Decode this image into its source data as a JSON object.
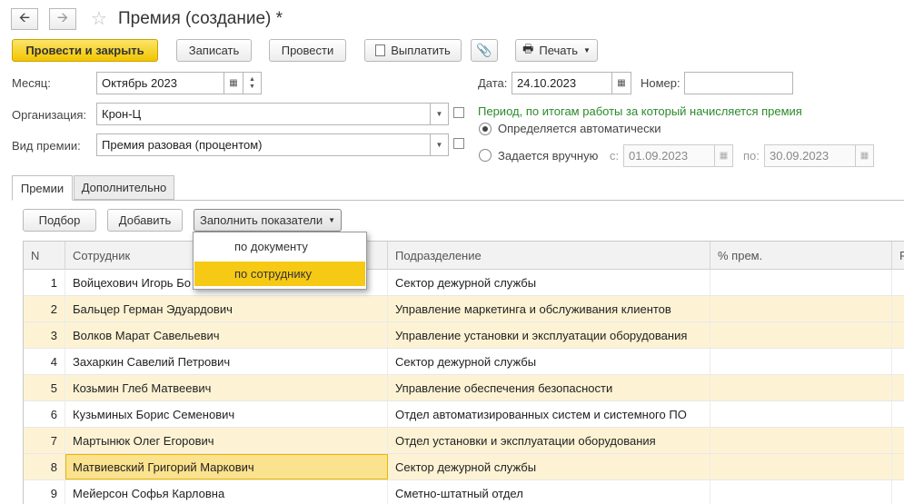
{
  "window": {
    "title": "Премия (создание) *",
    "back_icon": "arrow-left-icon",
    "forward_icon": "arrow-right-icon",
    "favorite_icon": "star-icon"
  },
  "toolbar": {
    "post_close": "Провести и закрыть",
    "save": "Записать",
    "post": "Провести",
    "pay": "Выплатить",
    "print": "Печать"
  },
  "form": {
    "month_label": "Месяц:",
    "month_value": "Октябрь 2023",
    "date_label": "Дата:",
    "date_value": "24.10.2023",
    "number_label": "Номер:",
    "number_value": "",
    "org_label": "Организация:",
    "org_value": "Крон-Ц",
    "bonus_type_label": "Вид премии:",
    "bonus_type_value": "Премия разовая (процентом)",
    "period_caption": "Период, по итогам работы за который начисляется премия",
    "radio_auto": "Определяется автоматически",
    "radio_manual": "Задается вручную",
    "from_label": "с:",
    "from_value": "01.09.2023",
    "to_label": "по:",
    "to_value": "30.09.2023"
  },
  "tabs": [
    "Премии",
    "Дополнительно"
  ],
  "grid_toolbar": {
    "select": "Подбор",
    "add": "Добавить",
    "fill": "Заполнить показатели"
  },
  "fill_menu": [
    "по документу",
    "по сотруднику"
  ],
  "table": {
    "columns": [
      "N",
      "Сотрудник",
      "Подразделение",
      "% прем.",
      "Р"
    ],
    "rows": [
      {
        "n": "1",
        "employee": "Войцехович Игорь Бо",
        "dept": "Сектор дежурной службы"
      },
      {
        "n": "2",
        "employee": "Бальцер Герман Эдуардович",
        "dept": "Управление маркетинга и обслуживания клиентов"
      },
      {
        "n": "3",
        "employee": "Волков Марат Савельевич",
        "dept": "Управление установки и эксплуатации оборудования"
      },
      {
        "n": "4",
        "employee": "Захаркин Савелий Петрович",
        "dept": "Сектор дежурной службы"
      },
      {
        "n": "5",
        "employee": "Козьмин Глеб Матвеевич",
        "dept": "Управление обеспечения безопасности"
      },
      {
        "n": "6",
        "employee": "Кузьминых Борис Семенович",
        "dept": "Отдел автоматизированных систем и системного ПО"
      },
      {
        "n": "7",
        "employee": "Мартынюк Олег Егорович",
        "dept": "Отдел установки и эксплуатации оборудования"
      },
      {
        "n": "8",
        "employee": "Матвиевский Григорий Маркович",
        "dept": "Сектор дежурной службы"
      },
      {
        "n": "9",
        "employee": "Мейерсон Софья Карловна",
        "dept": "Сметно-штатный отдел"
      }
    ]
  },
  "colors": {
    "primary_button": "#f2c500",
    "row_highlight": "#fdf3d4",
    "selected_cell": "#fbe28e",
    "period_caption": "#2a8a2a"
  }
}
